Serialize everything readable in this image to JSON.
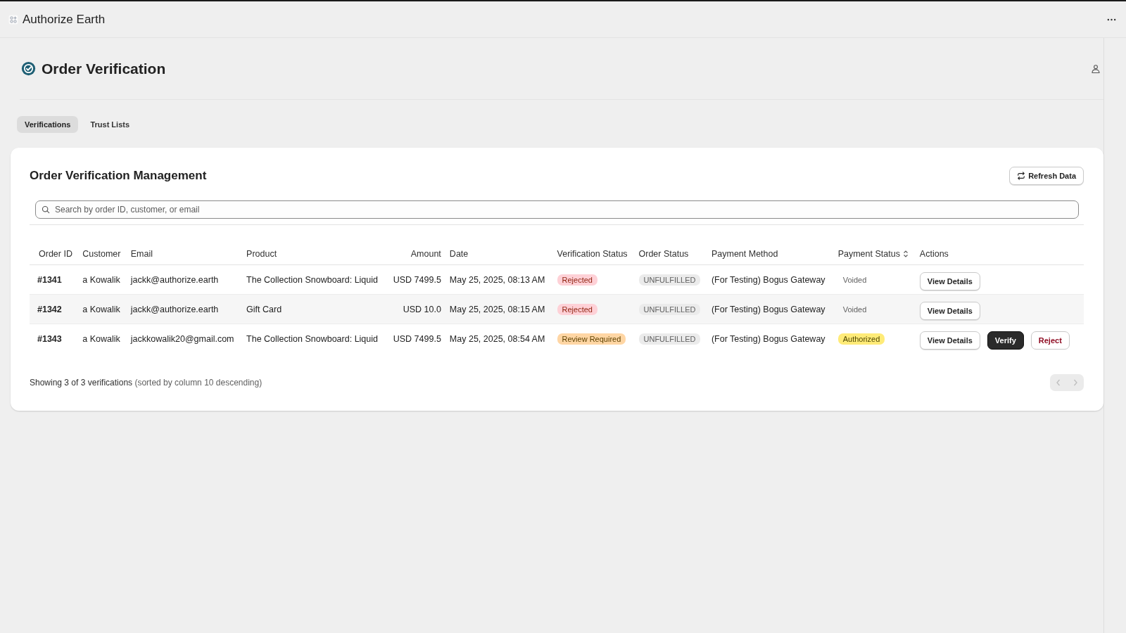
{
  "app": {
    "title": "Authorize Earth"
  },
  "page": {
    "title": "Order Verification"
  },
  "tabs": [
    {
      "label": "Verifications",
      "selected": true
    },
    {
      "label": "Trust Lists",
      "selected": false
    }
  ],
  "card": {
    "title": "Order Verification Management",
    "refresh_button": "Refresh Data",
    "search": {
      "placeholder": "Search by order ID, customer, or email"
    },
    "table": {
      "columns": [
        {
          "label": "Order ID",
          "sortable": false
        },
        {
          "label": "Customer",
          "sortable": false
        },
        {
          "label": "Email",
          "sortable": false
        },
        {
          "label": "Product",
          "sortable": false
        },
        {
          "label": "Amount",
          "sortable": false
        },
        {
          "label": "Date",
          "sortable": false
        },
        {
          "label": "Verification Status",
          "sortable": false
        },
        {
          "label": "Order Status",
          "sortable": false
        },
        {
          "label": "Payment Method",
          "sortable": false
        },
        {
          "label": "Payment Status",
          "sortable": true
        },
        {
          "label": "Actions",
          "sortable": false
        }
      ],
      "rows": [
        {
          "order_id": "#1341",
          "customer": "a Kowalik",
          "email": "jackk@authorize.earth",
          "product": "The Collection Snowboard: Liquid",
          "amount": "USD 7499.5",
          "date": "May 25, 2025, 08:13 AM",
          "verification_status": {
            "label": "Rejected",
            "kind": "danger"
          },
          "order_status": {
            "label": "UNFULFILLED",
            "kind": "neutral"
          },
          "payment_method": "(For Testing) Bogus Gateway",
          "payment_status": {
            "label": "Voided",
            "kind": "plain"
          },
          "actions": [
            {
              "label": "View Details",
              "kind": "default"
            }
          ]
        },
        {
          "order_id": "#1342",
          "customer": "a Kowalik",
          "email": "jackk@authorize.earth",
          "product": "Gift Card",
          "amount": "USD 10.0",
          "date": "May 25, 2025, 08:15 AM",
          "verification_status": {
            "label": "Rejected",
            "kind": "danger"
          },
          "order_status": {
            "label": "UNFULFILLED",
            "kind": "neutral"
          },
          "payment_method": "(For Testing) Bogus Gateway",
          "payment_status": {
            "label": "Voided",
            "kind": "plain"
          },
          "actions": [
            {
              "label": "View Details",
              "kind": "default"
            }
          ]
        },
        {
          "order_id": "#1343",
          "customer": "a Kowalik",
          "email": "jackkowalik20@gmail.com",
          "product": "The Collection Snowboard: Liquid",
          "amount": "USD 7499.5",
          "date": "May 25, 2025, 08:54 AM",
          "verification_status": {
            "label": "Review Required",
            "kind": "warning"
          },
          "order_status": {
            "label": "UNFULFILLED",
            "kind": "neutral"
          },
          "payment_method": "(For Testing) Bogus Gateway",
          "payment_status": {
            "label": "Authorized",
            "kind": "attention"
          },
          "actions": [
            {
              "label": "View Details",
              "kind": "default"
            },
            {
              "label": "Verify",
              "kind": "primary"
            },
            {
              "label": "Reject",
              "kind": "critical"
            }
          ]
        }
      ]
    },
    "footer": {
      "summary": "Showing 3 of 3 verifications",
      "sort_note": "(sorted by column 10 descending)",
      "pagination": {
        "previous_disabled": true,
        "next_disabled": true
      }
    }
  }
}
